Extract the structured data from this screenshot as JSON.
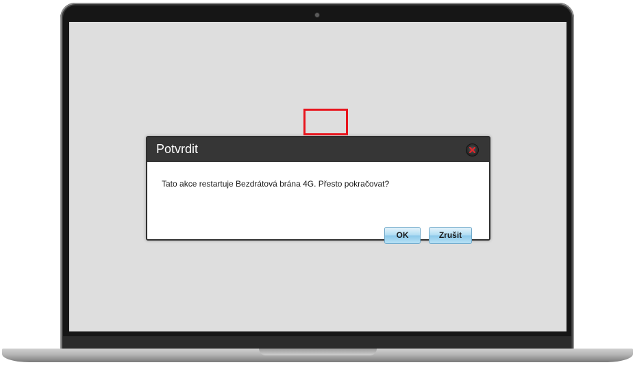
{
  "dialog": {
    "title": "Potvrdit",
    "message": "Tato akce restartuje Bezdrátová brána 4G. Přesto pokračovat?",
    "ok_label": "OK",
    "cancel_label": "Zrušit",
    "close_icon": "close-icon"
  },
  "colors": {
    "header_bg": "#363636",
    "screen_bg": "#dedede",
    "button_bg": "#aedbf2",
    "highlight": "#e8141c",
    "close_x": "#e0262b"
  }
}
